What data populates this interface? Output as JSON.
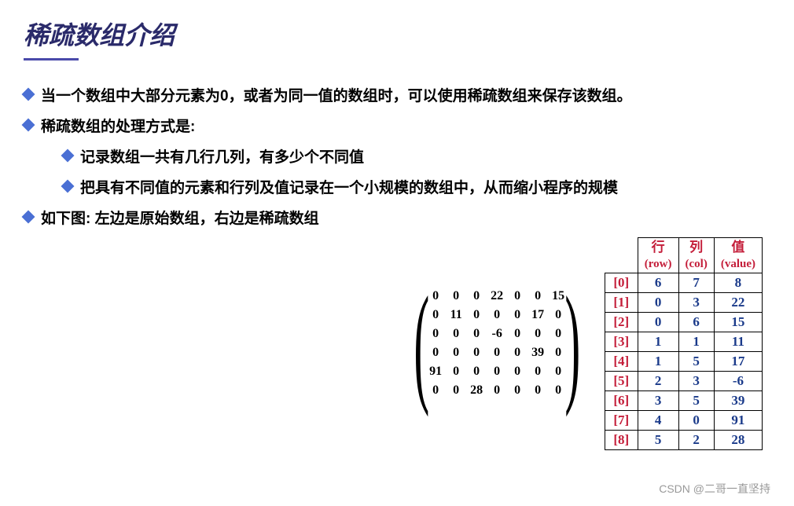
{
  "title": "稀疏数组介绍",
  "bullets": {
    "b1": "当一个数组中大部分元素为0，或者为同一值的数组时，可以使用稀疏数组来保存该数组。",
    "b2": "稀疏数组的处理方式是:",
    "b2a": "记录数组一共有几行几列，有多少个不同值",
    "b2b": "把具有不同值的元素和行列及值记录在一个小规模的数组中，从而缩小程序的规模",
    "b3": "如下图: 左边是原始数组，右边是稀疏数组"
  },
  "matrix": {
    "rows": [
      [
        "0",
        "0",
        "0",
        "22",
        "0",
        "0",
        "15"
      ],
      [
        "0",
        "11",
        "0",
        "0",
        "0",
        "17",
        "0"
      ],
      [
        "0",
        "0",
        "0",
        "-6",
        "0",
        "0",
        "0"
      ],
      [
        "0",
        "0",
        "0",
        "0",
        "0",
        "39",
        "0"
      ],
      [
        "91",
        "0",
        "0",
        "0",
        "0",
        "0",
        "0"
      ],
      [
        "0",
        "0",
        "28",
        "0",
        "0",
        "0",
        "0"
      ]
    ]
  },
  "sparse": {
    "headers": {
      "row": "行",
      "row_sub": "(row)",
      "col": "列",
      "col_sub": "(col)",
      "val": "值",
      "val_sub": "(value)"
    },
    "rows": [
      {
        "idx": "[0]",
        "r": "6",
        "c": "7",
        "v": "8"
      },
      {
        "idx": "[1]",
        "r": "0",
        "c": "3",
        "v": "22"
      },
      {
        "idx": "[2]",
        "r": "0",
        "c": "6",
        "v": "15"
      },
      {
        "idx": "[3]",
        "r": "1",
        "c": "1",
        "v": "11"
      },
      {
        "idx": "[4]",
        "r": "1",
        "c": "5",
        "v": "17"
      },
      {
        "idx": "[5]",
        "r": "2",
        "c": "3",
        "v": "-6"
      },
      {
        "idx": "[6]",
        "r": "3",
        "c": "5",
        "v": "39"
      },
      {
        "idx": "[7]",
        "r": "4",
        "c": "0",
        "v": "91"
      },
      {
        "idx": "[8]",
        "r": "5",
        "c": "2",
        "v": "28"
      }
    ]
  },
  "watermark": "CSDN @二哥一直坚持"
}
